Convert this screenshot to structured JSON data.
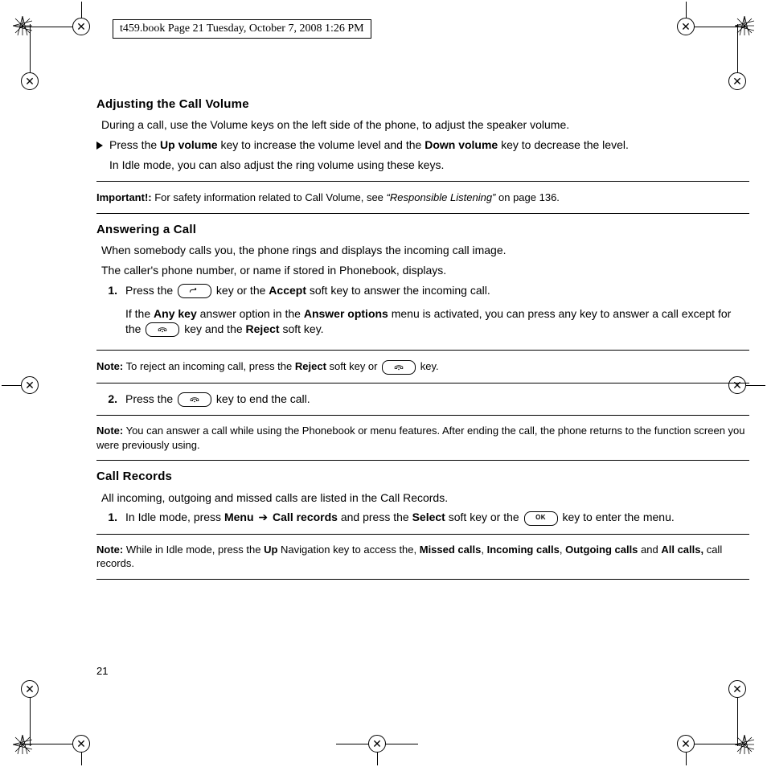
{
  "meta": {
    "title": "t459.book  Page 21  Tuesday, October 7, 2008  1:26 PM",
    "page_number": "21"
  },
  "s1": {
    "heading": "Adjusting the Call Volume",
    "p1": "During a call, use the Volume keys on the left side of the phone, to adjust the speaker volume.",
    "bullet_pre": "Press the ",
    "up_volume": "Up volume",
    "bullet_mid": " key to increase the volume level and the ",
    "down_volume": "Down volume",
    "bullet_post": " key to decrease the level.",
    "p2": "In Idle mode, you can also adjust the ring volume using these keys.",
    "note_label": "Important!:",
    "note_body_pre": " For safety information related to Call Volume, see ",
    "note_ref": "“Responsible Listening”",
    "note_body_post": " on page 136."
  },
  "s2": {
    "heading": "Answering a Call",
    "p1": "When somebody calls you, the phone rings and displays the incoming call image.",
    "p2": "The caller's phone number, or name if stored in Phonebook, displays.",
    "li1": {
      "num": "1.",
      "a": "Press the ",
      "b": " key or the ",
      "accept": "Accept",
      "c": " soft key to answer the incoming call.",
      "d": "If the ",
      "anykey": "Any key",
      "e": " answer option in the ",
      "answeroptions": "Answer options",
      "f": " menu is activated, you can press any key to answer a call except for the ",
      "g": " key and the ",
      "reject": "Reject",
      "h": " soft key."
    },
    "note1": {
      "label": "Note:",
      "a": " To reject an incoming call, press the ",
      "reject": "Reject",
      "b": " soft key or ",
      "c": " key."
    },
    "li2": {
      "num": "2.",
      "a": "Press the ",
      "b": " key to end the call."
    },
    "note2": {
      "label": "Note:",
      "a": " You can answer a call while using the Phonebook or menu features. After ending the call, the phone returns to the function screen you were previously using."
    }
  },
  "s3": {
    "heading": "Call Records",
    "p1": "All incoming, outgoing and missed calls are listed in the Call Records.",
    "li1": {
      "num": "1.",
      "a": "In Idle mode, press ",
      "menu": "Menu",
      "arrow": " ➔ ",
      "callrecords": "Call records",
      "b": " and press the ",
      "select": "Select",
      "c": " soft key or the ",
      "d": " key to enter the menu."
    },
    "note": {
      "label": "Note:",
      "a": " While in Idle mode, press the ",
      "up": "Up",
      "b": " Navigation key to access the, ",
      "missed": "Missed calls",
      "c": ", ",
      "incoming": "Incoming calls",
      "d": ", ",
      "outgoing": "Outgoing calls",
      "e": " and ",
      "allcalls": "All calls,",
      "f": " call records."
    }
  },
  "icons": {
    "send": "send-key",
    "end": "end-key",
    "ok": "OK"
  }
}
